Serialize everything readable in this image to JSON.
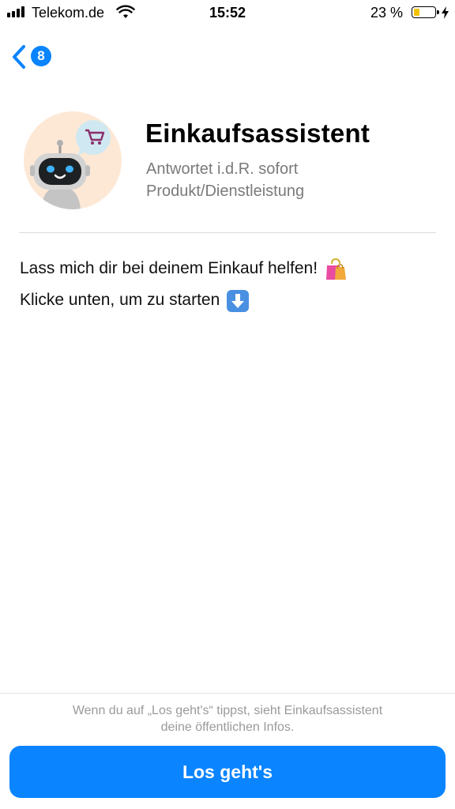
{
  "status_bar": {
    "carrier": "Telekom.de",
    "time": "15:52",
    "battery_percent": "23 %",
    "battery_level": 0.23,
    "battery_color": "#f2c200"
  },
  "nav": {
    "back_icon": "chevron-left-icon",
    "unread_count": "8",
    "accent_color": "#0a84ff"
  },
  "profile": {
    "name": "Einkaufsassistent",
    "response_time": "Antwortet i.d.R. sofort",
    "category": "Produkt/Dienstleistung",
    "avatar_icon": "robot-with-cart-icon"
  },
  "message": {
    "line1": "Lass mich dir bei deinem Einkauf helfen!",
    "line1_emoji": "shopping-bags-icon",
    "line2": "Klicke unten, um zu starten",
    "line2_emoji": "down-arrow-icon"
  },
  "footer": {
    "disclaimer_line1": "Wenn du auf „Los geht's“ tippst, sieht Einkaufsassistent",
    "disclaimer_line2": "deine öffentlichen Infos.",
    "button_label": "Los geht's",
    "button_color": "#0a84ff"
  }
}
